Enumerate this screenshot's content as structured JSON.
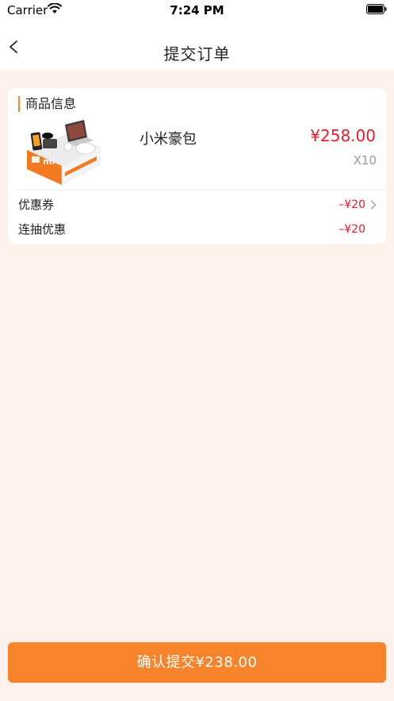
{
  "status_bar": {
    "carrier": "Carrier",
    "time": "7:24 PM"
  },
  "nav": {
    "title": "提交订单",
    "back_icon": "chevron-left-icon"
  },
  "order": {
    "section_title": "商品信息",
    "product": {
      "name": "小米豪包",
      "price": "¥258.00",
      "quantity": "X10"
    },
    "discounts": [
      {
        "label": "优惠券",
        "value": "–¥20",
        "has_arrow": true
      },
      {
        "label": "连抽优惠",
        "value": "–¥20",
        "has_arrow": false
      }
    ]
  },
  "footer": {
    "submit_label": "确认提交¥238.00"
  },
  "colors": {
    "accent": "#f7842b",
    "price": "#f0182b",
    "page_bg": "#fff1ec"
  }
}
